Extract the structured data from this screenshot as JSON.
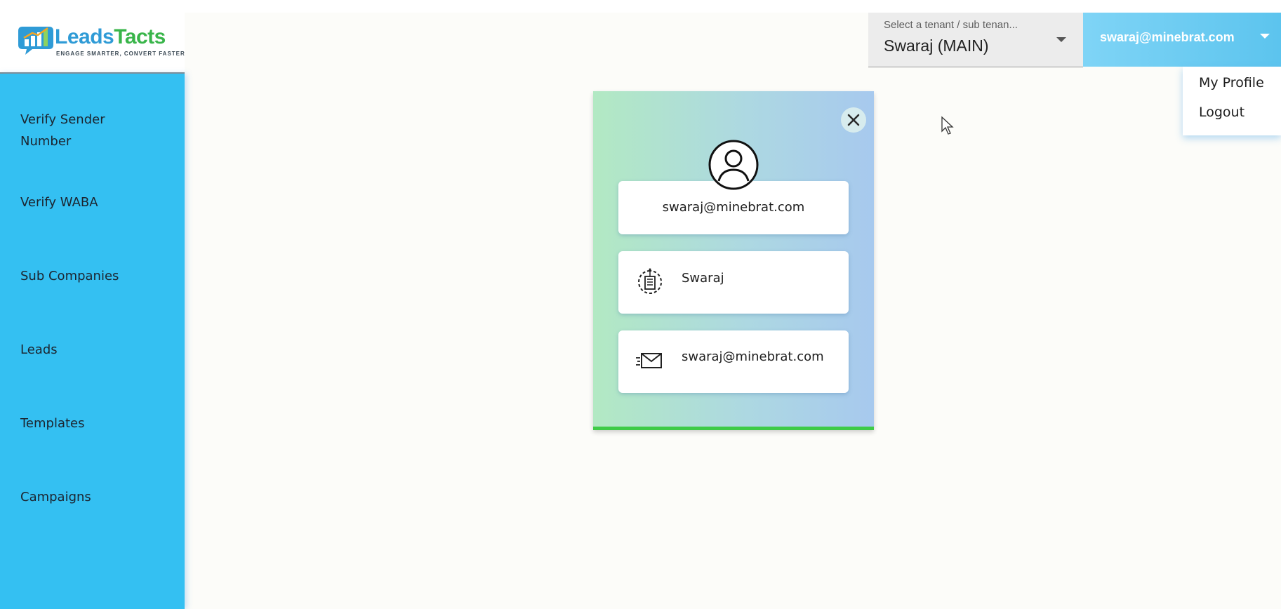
{
  "brand": {
    "logo_part1": "Leads",
    "logo_part2": "Tacts",
    "tagline": "ENGAGE SMARTER, CONVERT FASTER"
  },
  "sidebar": {
    "items": [
      {
        "label": "Verify Sender Number"
      },
      {
        "label": "Verify WABA"
      },
      {
        "label": "Sub Companies"
      },
      {
        "label": "Leads"
      },
      {
        "label": "Templates"
      },
      {
        "label": "Campaigns"
      }
    ]
  },
  "header": {
    "tenant_select": {
      "label": "Select a tenant / sub tenan...",
      "value": "Swaraj (MAIN)"
    },
    "user_email": "swaraj@minebrat.com"
  },
  "user_menu": {
    "items": [
      {
        "label": "My Profile"
      },
      {
        "label": "Logout"
      }
    ]
  },
  "profile_card": {
    "email_heading": "swaraj@minebrat.com",
    "company": "Swaraj",
    "email": "swaraj@minebrat.com"
  },
  "colors": {
    "sidebar": "#34c0f2",
    "accent_green": "#3ecb47",
    "user_button": "#5cc4ee"
  },
  "icons": {
    "logo": "chat-bar-chart-icon",
    "close": "close-icon",
    "avatar": "user-circle-icon",
    "company": "company-gear-building-icon",
    "email": "envelope-speed-icon",
    "caret": "caret-down-icon",
    "cursor": "mouse-pointer-icon"
  }
}
